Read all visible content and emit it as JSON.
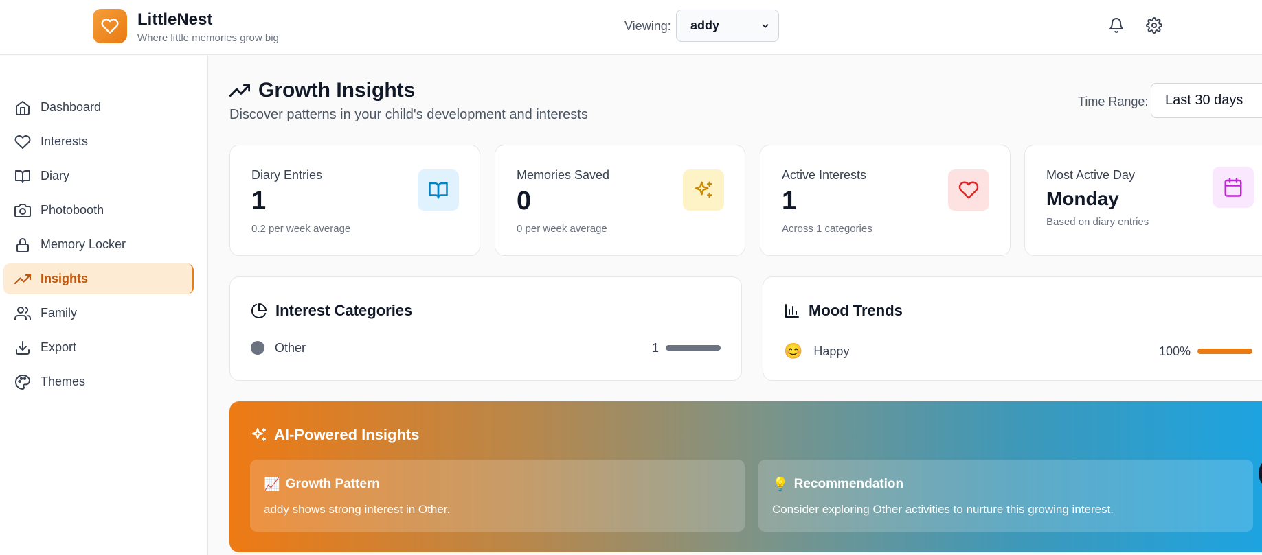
{
  "app": {
    "name": "LittleNest",
    "tagline": "Where little memories grow big"
  },
  "header": {
    "viewing_label": "Viewing:",
    "viewing_value": "addy"
  },
  "sidebar": {
    "items": [
      {
        "label": "Dashboard",
        "icon": "home-icon"
      },
      {
        "label": "Interests",
        "icon": "heart-icon"
      },
      {
        "label": "Diary",
        "icon": "book-icon"
      },
      {
        "label": "Photobooth",
        "icon": "camera-icon"
      },
      {
        "label": "Memory Locker",
        "icon": "lock-icon"
      },
      {
        "label": "Insights",
        "icon": "trending-up-icon",
        "active": true
      },
      {
        "label": "Family",
        "icon": "users-icon"
      },
      {
        "label": "Export",
        "icon": "download-icon"
      },
      {
        "label": "Themes",
        "icon": "palette-icon"
      }
    ]
  },
  "main": {
    "title": "Growth Insights",
    "subtitle": "Discover patterns in your child's development and interests",
    "time_range_label": "Time Range:",
    "time_range_value": "Last 30 days",
    "stats": [
      {
        "label": "Diary Entries",
        "value": "1",
        "note": "0.2 per week average",
        "icon": "book-open-icon",
        "color": "#0284c7"
      },
      {
        "label": "Memories Saved",
        "value": "0",
        "note": "0 per week average",
        "icon": "sparkles-icon",
        "color": "#ca8a04"
      },
      {
        "label": "Active Interests",
        "value": "1",
        "note": "Across 1 categories",
        "icon": "heart-icon",
        "color": "#dc2626"
      },
      {
        "label": "Most Active Day",
        "value": "Monday",
        "note": "Based on diary entries",
        "icon": "calendar-icon",
        "color": "#c026d3"
      }
    ],
    "interest_categories": {
      "title": "Interest Categories",
      "items": [
        {
          "label": "Other",
          "count": "1",
          "fill": 1.0,
          "color": "#6b7280"
        }
      ]
    },
    "mood_trends": {
      "title": "Mood Trends",
      "items": [
        {
          "emoji": "😊",
          "label": "Happy",
          "percent": "100%",
          "fill": 1.0,
          "color": "#ea7a12"
        }
      ]
    },
    "ai_insights": {
      "title": "AI-Powered Insights",
      "cards": [
        {
          "emoji": "📈",
          "title": "Growth Pattern",
          "text": "addy shows strong interest in Other."
        },
        {
          "emoji": "💡",
          "title": "Recommendation",
          "text": "Consider exploring Other activities to nurture this growing interest."
        }
      ]
    }
  }
}
